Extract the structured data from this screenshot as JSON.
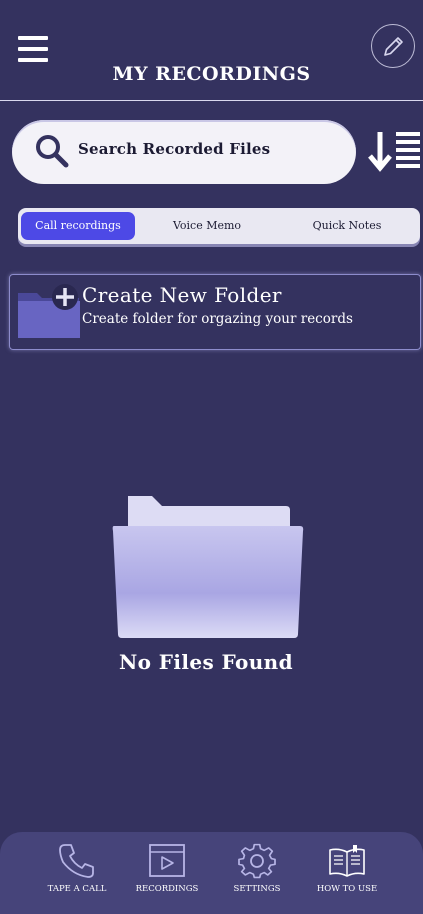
{
  "header": {
    "title": "MY RECORDINGS",
    "menu_icon": "hamburger-menu-icon",
    "edit_icon": "pencil-icon"
  },
  "search": {
    "placeholder": "Search Recorded Files",
    "icon": "search-icon",
    "sort_icon": "sort-down-icon"
  },
  "tabs": [
    {
      "label": "Call recordings",
      "active": true
    },
    {
      "label": "Voice Memo",
      "active": false
    },
    {
      "label": "Quick Notes",
      "active": false
    }
  ],
  "create_folder": {
    "title": "Create New Folder",
    "subtitle": "Create folder for orgazing your records",
    "icon": "folder-add-icon"
  },
  "empty_state": {
    "text": "No Files Found",
    "icon": "empty-folder-icon"
  },
  "bottom_nav": [
    {
      "label": "TAPE A CALL",
      "icon": "phone-icon"
    },
    {
      "label": "RECORDINGS",
      "icon": "video-player-icon"
    },
    {
      "label": "SETTINGS",
      "icon": "gear-icon"
    },
    {
      "label": "HOW TO USE",
      "icon": "book-icon"
    }
  ],
  "colors": {
    "background": "#34325f",
    "accent": "#4d49e6",
    "nav_background": "#46447a"
  }
}
